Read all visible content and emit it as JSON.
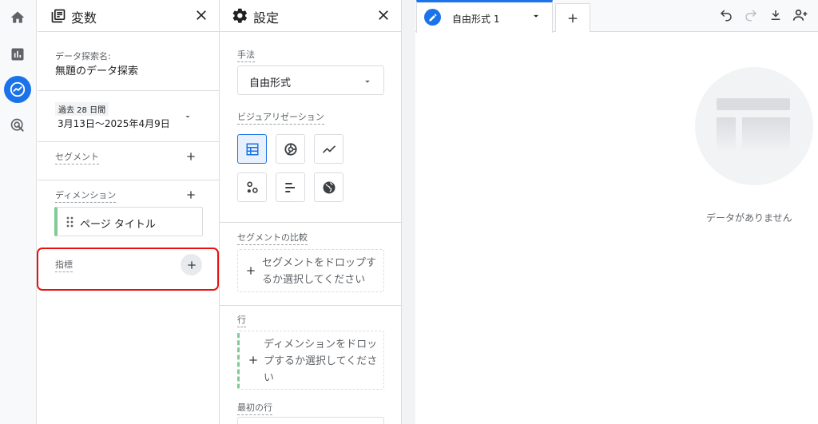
{
  "rail": {
    "items": [
      {
        "icon": "home-icon"
      },
      {
        "icon": "reports-icon"
      },
      {
        "icon": "explore-icon"
      },
      {
        "icon": "advertising-icon"
      }
    ]
  },
  "variables": {
    "title": "変数",
    "exploration_name_label": "データ探索名:",
    "exploration_name": "無題のデータ探索",
    "date_preset": "過去 28 日間",
    "date_range": "3月13日～2025年4月9日",
    "segments_label": "セグメント",
    "dimensions_label": "ディメンション",
    "dimension_chip": "ページ タイトル",
    "metrics_label": "指標"
  },
  "settings": {
    "title": "設定",
    "technique_label": "手法",
    "technique_value": "自由形式",
    "visualization_label": "ビジュアリゼーション",
    "segment_compare_label": "セグメントの比較",
    "segment_drop_text": "セグメントをドロップするか選択してください",
    "rows_label": "行",
    "rows_drop_text": "ディメンションをドロップするか選択してください",
    "first_row_label": "最初の行"
  },
  "canvas": {
    "tab_label": "自由形式 1",
    "no_data": "データがありません"
  },
  "colors": {
    "accent": "#1a73e8",
    "highlight": "#e8110f",
    "chip_bar": "#81c995"
  }
}
